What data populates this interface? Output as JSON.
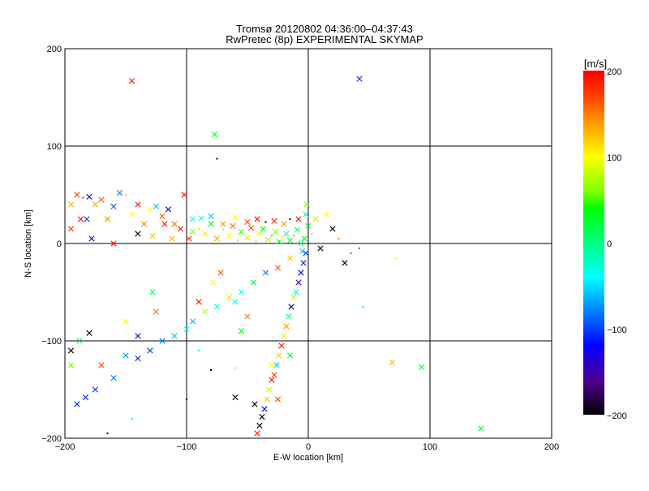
{
  "chart_data": {
    "type": "scatter",
    "title": "Tromsø 20120802 04:36:00–04:37:43",
    "subtitle": "RwPretec (8p) EXPERIMENTAL SKYMAP",
    "xlabel": "E-W location [km]",
    "ylabel": "N-S location [km]",
    "xlim": [
      -200,
      200
    ],
    "ylim": [
      -200,
      200
    ],
    "xticks": [
      "-200",
      "-100",
      "0",
      "100",
      "200"
    ],
    "yticks": [
      "-200",
      "-100",
      "0",
      "100",
      "200"
    ],
    "grid": true,
    "colorbar": {
      "label": "[m/s]",
      "range": [
        -200,
        200
      ],
      "ticks": [
        "200",
        "100",
        "0",
        "-100",
        "-200"
      ],
      "stops": [
        [
          200,
          "#ff0000"
        ],
        [
          170,
          "#ff4000"
        ],
        [
          140,
          "#ff9900"
        ],
        [
          100,
          "#ffff00"
        ],
        [
          60,
          "#80ff00"
        ],
        [
          40,
          "#00ff00"
        ],
        [
          0,
          "#00ff80"
        ],
        [
          -40,
          "#00ffff"
        ],
        [
          -80,
          "#0080ff"
        ],
        [
          -120,
          "#0000ff"
        ],
        [
          -160,
          "#500090"
        ],
        [
          -200,
          "#000000"
        ]
      ]
    },
    "point_fields": [
      "x_km",
      "y_km",
      "velocity_ms",
      "marker_cross"
    ],
    "points": [
      [
        -145,
        167,
        190,
        1
      ],
      [
        42,
        169,
        -110,
        1
      ],
      [
        -77,
        112,
        30,
        1
      ],
      [
        -75,
        87,
        -200,
        0
      ],
      [
        -95,
        12,
        60,
        1
      ],
      [
        -90,
        15,
        120,
        0
      ],
      [
        -85,
        10,
        90,
        1
      ],
      [
        -80,
        20,
        40,
        1
      ],
      [
        -75,
        5,
        130,
        1
      ],
      [
        -70,
        14,
        80,
        0
      ],
      [
        -65,
        8,
        100,
        1
      ],
      [
        -62,
        18,
        150,
        1
      ],
      [
        -58,
        3,
        70,
        0
      ],
      [
        -55,
        12,
        50,
        1
      ],
      [
        -50,
        6,
        110,
        1
      ],
      [
        -47,
        16,
        170,
        1
      ],
      [
        -43,
        2,
        60,
        0
      ],
      [
        -40,
        10,
        90,
        1
      ],
      [
        -37,
        15,
        30,
        1
      ],
      [
        -33,
        4,
        80,
        1
      ],
      [
        -30,
        8,
        40,
        0
      ],
      [
        -27,
        12,
        60,
        1
      ],
      [
        -24,
        2,
        20,
        1
      ],
      [
        -21,
        6,
        100,
        1
      ],
      [
        -18,
        10,
        -30,
        1
      ],
      [
        -15,
        3,
        30,
        1
      ],
      [
        -12,
        8,
        50,
        0
      ],
      [
        -9,
        14,
        10,
        1
      ],
      [
        -6,
        0,
        -20,
        1
      ],
      [
        -3,
        5,
        40,
        1
      ],
      [
        0,
        18,
        20,
        1
      ],
      [
        3,
        10,
        60,
        0
      ],
      [
        6,
        25,
        80,
        1
      ],
      [
        -2,
        30,
        -10,
        1
      ],
      [
        -8,
        25,
        190,
        1
      ],
      [
        -20,
        20,
        140,
        1
      ],
      [
        -35,
        22,
        -200,
        0
      ],
      [
        10,
        -5,
        -200,
        1
      ],
      [
        20,
        15,
        -200,
        1
      ],
      [
        25,
        5,
        150,
        0
      ],
      [
        15,
        30,
        100,
        1
      ],
      [
        -1,
        40,
        60,
        1
      ],
      [
        -95,
        25,
        -40,
        1
      ],
      [
        -88,
        26,
        -30,
        1
      ],
      [
        -80,
        28,
        -60,
        1
      ],
      [
        -70,
        20,
        140,
        1
      ],
      [
        -60,
        27,
        100,
        1
      ],
      [
        -50,
        22,
        170,
        1
      ],
      [
        -42,
        25,
        190,
        1
      ],
      [
        -28,
        23,
        180,
        1
      ],
      [
        -15,
        25,
        -200,
        0
      ],
      [
        -195,
        40,
        130,
        1
      ],
      [
        -190,
        50,
        170,
        1
      ],
      [
        -185,
        47,
        190,
        0
      ],
      [
        -180,
        48,
        -120,
        1
      ],
      [
        -175,
        40,
        130,
        1
      ],
      [
        -170,
        45,
        160,
        1
      ],
      [
        -165,
        25,
        140,
        1
      ],
      [
        -160,
        38,
        -90,
        1
      ],
      [
        -155,
        52,
        -80,
        1
      ],
      [
        -150,
        50,
        120,
        0
      ],
      [
        -145,
        30,
        100,
        1
      ],
      [
        -140,
        40,
        190,
        1
      ],
      [
        -135,
        20,
        150,
        1
      ],
      [
        -130,
        35,
        100,
        1
      ],
      [
        -125,
        38,
        -60,
        1
      ],
      [
        -120,
        28,
        160,
        1
      ],
      [
        -118,
        20,
        190,
        1
      ],
      [
        -115,
        35,
        -120,
        1
      ],
      [
        -110,
        20,
        150,
        1
      ],
      [
        -105,
        15,
        180,
        1
      ],
      [
        -102,
        50,
        190,
        1
      ],
      [
        -195,
        15,
        170,
        1
      ],
      [
        -187,
        25,
        190,
        1
      ],
      [
        -182,
        25,
        -100,
        1
      ],
      [
        -178,
        5,
        -150,
        1
      ],
      [
        -160,
        0,
        190,
        1
      ],
      [
        -140,
        10,
        -200,
        1
      ],
      [
        -128,
        8,
        120,
        1
      ],
      [
        -112,
        5,
        130,
        1
      ],
      [
        -98,
        5,
        170,
        1
      ],
      [
        -2,
        -10,
        -100,
        1
      ],
      [
        -4,
        -20,
        -110,
        1
      ],
      [
        -6,
        -30,
        -120,
        1
      ],
      [
        -8,
        -40,
        -150,
        1
      ],
      [
        -10,
        -50,
        -30,
        1
      ],
      [
        -12,
        -55,
        80,
        1
      ],
      [
        -14,
        -65,
        -180,
        1
      ],
      [
        -16,
        -75,
        -10,
        1
      ],
      [
        -18,
        -85,
        140,
        1
      ],
      [
        -20,
        -95,
        110,
        1
      ],
      [
        -22,
        -105,
        190,
        1
      ],
      [
        -24,
        -115,
        120,
        1
      ],
      [
        -26,
        -125,
        -60,
        1
      ],
      [
        -28,
        -135,
        170,
        1
      ],
      [
        -30,
        -140,
        190,
        1
      ],
      [
        -32,
        -150,
        80,
        1
      ],
      [
        -34,
        -160,
        120,
        1
      ],
      [
        -36,
        -170,
        -120,
        1
      ],
      [
        -38,
        -178,
        -200,
        1
      ],
      [
        -40,
        -187,
        -200,
        1
      ],
      [
        -42,
        -195,
        190,
        1
      ],
      [
        -44,
        -165,
        -200,
        1
      ],
      [
        -25,
        -160,
        170,
        1
      ],
      [
        -30,
        -125,
        100,
        1
      ],
      [
        -5,
        -8,
        -50,
        1
      ],
      [
        -15,
        -15,
        120,
        1
      ],
      [
        -25,
        -25,
        160,
        1
      ],
      [
        -35,
        -30,
        -80,
        1
      ],
      [
        -45,
        -40,
        20,
        1
      ],
      [
        -55,
        -50,
        -40,
        1
      ],
      [
        -65,
        -55,
        110,
        1
      ],
      [
        -75,
        -65,
        -30,
        1
      ],
      [
        -85,
        -70,
        80,
        1
      ],
      [
        -95,
        -80,
        -60,
        1
      ],
      [
        -100,
        -88,
        -40,
        1
      ],
      [
        -78,
        -40,
        100,
        1
      ],
      [
        -72,
        -30,
        160,
        1
      ],
      [
        -60,
        -60,
        -30,
        1
      ],
      [
        -50,
        -75,
        150,
        1
      ],
      [
        -90,
        -60,
        190,
        1
      ],
      [
        -190,
        -165,
        -110,
        1
      ],
      [
        -183,
        -158,
        -110,
        1
      ],
      [
        -175,
        -150,
        -100,
        1
      ],
      [
        -160,
        -138,
        -80,
        1
      ],
      [
        -150,
        -115,
        -70,
        1
      ],
      [
        -140,
        -118,
        -110,
        1
      ],
      [
        -130,
        -110,
        -100,
        1
      ],
      [
        -120,
        -100,
        -80,
        1
      ],
      [
        -110,
        -95,
        -60,
        1
      ],
      [
        -195,
        -110,
        -200,
        1
      ],
      [
        -188,
        -100,
        20,
        1
      ],
      [
        -180,
        -92,
        -200,
        1
      ],
      [
        -150,
        -80,
        100,
        1
      ],
      [
        -140,
        -95,
        -130,
        1
      ],
      [
        -125,
        -70,
        150,
        1
      ],
      [
        -128,
        -50,
        10,
        1
      ],
      [
        -195,
        -125,
        60,
        1
      ],
      [
        -170,
        -125,
        170,
        1
      ],
      [
        69,
        -122,
        130,
        1
      ],
      [
        93,
        -127,
        20,
        1
      ],
      [
        142,
        -190,
        30,
        1
      ],
      [
        45,
        -65,
        40,
        0
      ],
      [
        72,
        -15,
        100,
        0
      ],
      [
        30,
        -20,
        -200,
        1
      ],
      [
        35,
        -10,
        170,
        0
      ],
      [
        42,
        -5,
        190,
        0
      ],
      [
        -80,
        -130,
        -200,
        0
      ],
      [
        -100,
        -160,
        -200,
        0
      ],
      [
        -60,
        -128,
        70,
        0
      ],
      [
        -145,
        -180,
        20,
        0
      ],
      [
        -165,
        -195,
        -200,
        0
      ],
      [
        -90,
        -110,
        -10,
        0
      ],
      [
        -55,
        -90,
        40,
        1
      ],
      [
        -15,
        -115,
        20,
        1
      ],
      [
        -60,
        -158,
        -200,
        1
      ]
    ]
  }
}
